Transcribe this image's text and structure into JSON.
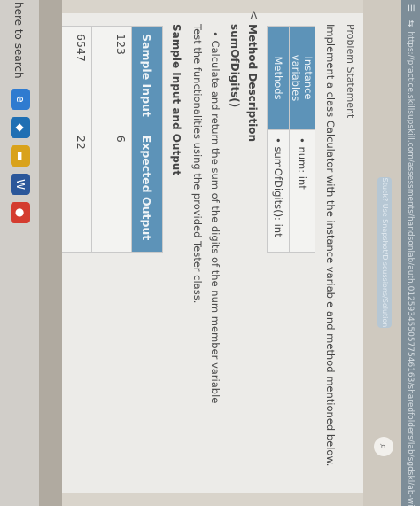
{
  "browser": {
    "url": "https://practice.skillsupskill.com/assessments/handsonlab/auth.0125934550577546163/sharedfolders/lab/sgdskl/ab-with-0125934547",
    "colors": {
      "bar": "#7d8d98"
    }
  },
  "header": {
    "pill_text": "Stuck? Use Snapshot/Discussions/Solution",
    "search_glyph": "⌕"
  },
  "problem": {
    "title": "Problem Statement",
    "description": "Implement a class Calculator with the instance variable and method mentioned below."
  },
  "class_table": {
    "rows": [
      {
        "label": "Instance variables",
        "value": "num: int",
        "bullet": "•"
      },
      {
        "label": "Methods",
        "value": "sumOfDigits(): int",
        "bullet": "•"
      }
    ]
  },
  "method": {
    "back_glyph": "<",
    "heading": "Method Description",
    "name": "sumOfDigits()",
    "bullet": "•",
    "desc_1": "Calculate and return the sum of the digits of the num member variable",
    "desc_2": "Test the functionalities using the provided Tester class."
  },
  "io": {
    "heading": "Sample Input and Output",
    "columns": [
      "Sample Input",
      "Expected Output"
    ],
    "rows": [
      [
        "123",
        "6"
      ],
      [
        "6547",
        "22"
      ]
    ]
  },
  "taskbar": {
    "search_text": "here to search",
    "icons": [
      {
        "name": "edge-icon",
        "glyph": "e",
        "color": "#2f7bd0"
      },
      {
        "name": "dropbox-icon",
        "glyph": "◆",
        "color": "#1f6fb3"
      },
      {
        "name": "file-explorer-icon",
        "glyph": "▬",
        "color": "#d9a21b"
      },
      {
        "name": "word-icon",
        "glyph": "W",
        "color": "#2b579a"
      },
      {
        "name": "chrome-icon",
        "glyph": "●",
        "color": "#d43c2f"
      }
    ]
  },
  "colors": {
    "accent": "#5d93b8",
    "panel": "#ecebe8"
  }
}
